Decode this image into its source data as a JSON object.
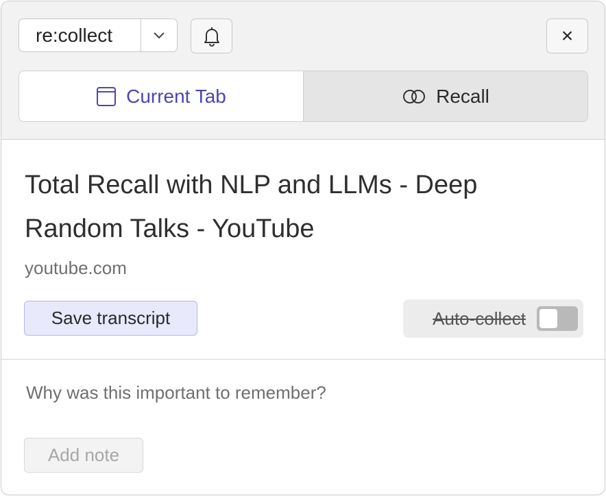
{
  "header": {
    "app_name": "re:collect",
    "tabs": [
      {
        "label": "Current Tab",
        "icon": "window-icon",
        "active": true
      },
      {
        "label": "Recall",
        "icon": "overlap-circles-icon",
        "active": false
      }
    ],
    "close_label": "×"
  },
  "page": {
    "title": "Total Recall with NLP and LLMs - Deep Random Talks - YouTube",
    "domain": "youtube.com"
  },
  "actions": {
    "save_transcript_label": "Save transcript",
    "auto_collect_label": "Auto-collect",
    "auto_collect_on": false
  },
  "note": {
    "placeholder": "Why was this important to remember?",
    "value": "",
    "add_note_label": "Add note"
  },
  "colors": {
    "accent": "#4b45b5",
    "save_bg": "#e8e9fb",
    "header_bg": "#f2f2f2"
  }
}
